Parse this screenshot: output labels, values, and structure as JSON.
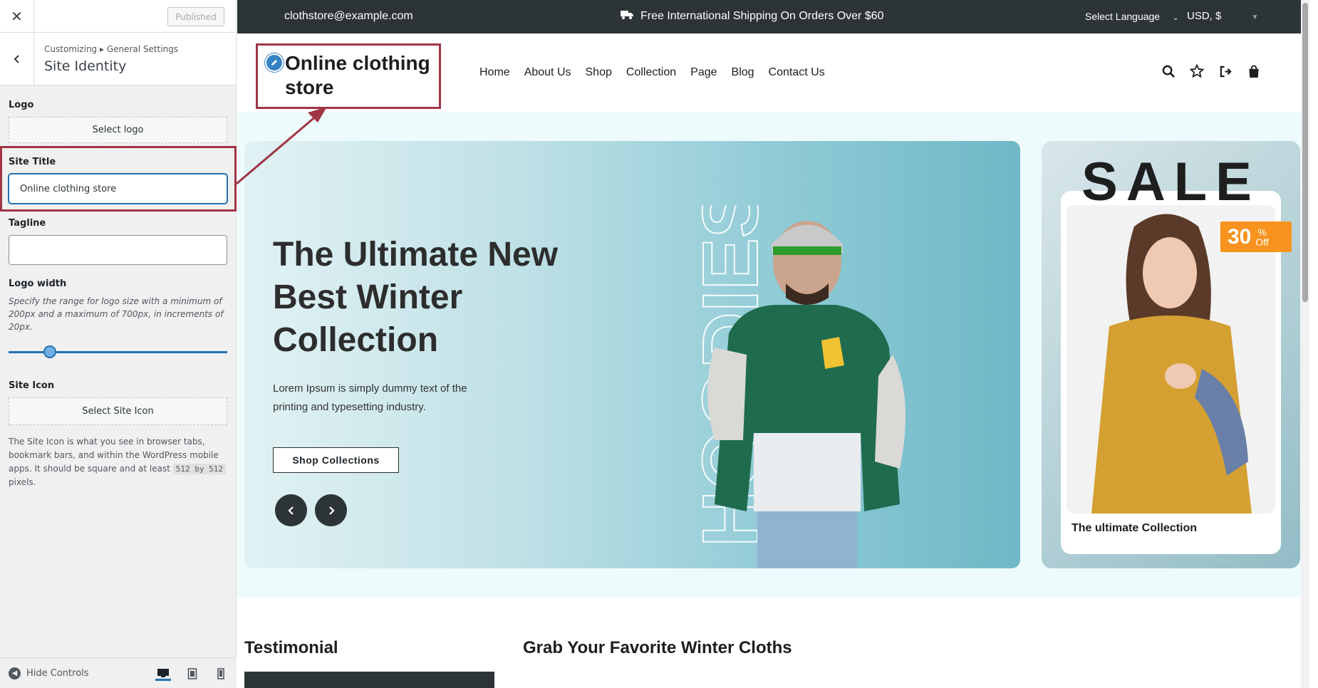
{
  "customizer": {
    "close_glyph": "✕",
    "published_label": "Published",
    "breadcrumb": "Customizing ▸ General Settings",
    "section_title": "Site Identity",
    "logo": {
      "label": "Logo",
      "button": "Select logo"
    },
    "site_title": {
      "label": "Site Title",
      "value": "Online clothing store"
    },
    "tagline": {
      "label": "Tagline",
      "value": ""
    },
    "logo_width": {
      "label": "Logo width",
      "hint": "Specify the range for logo size with a minimum of 200px and a maximum of 700px, in increments of 20px.",
      "value_fraction": 0.19
    },
    "site_icon": {
      "label": "Site Icon",
      "button": "Select Site Icon",
      "help_before": "The Site Icon is what you see in browser tabs, bookmark bars, and within the WordPress mobile apps. It should be square and at least",
      "help_code": "512 by 512",
      "help_after": "pixels."
    },
    "hide_controls": "Hide Controls",
    "devices": [
      "desktop-icon",
      "tablet-icon",
      "mobile-icon"
    ]
  },
  "topbar": {
    "email": "clothstore@example.com",
    "shipping": "Free International Shipping On Orders Over $60",
    "language": "Select Language",
    "currency": "USD, $"
  },
  "header": {
    "site_title": "Online clothing store",
    "nav": [
      "Home",
      "About Us",
      "Shop",
      "Collection",
      "Page",
      "Blog",
      "Contact Us"
    ]
  },
  "hero": {
    "heading": "The Ultimate New Best Winter Collection",
    "text": "Lorem Ipsum is simply dummy text of the printing and typesetting industry.",
    "button": "Shop Collections",
    "vertical_word": "HOODIES"
  },
  "sale": {
    "word": "SALE",
    "badge_number": "30",
    "badge_pct": "%",
    "badge_off": "Off",
    "caption": "The ultimate Collection"
  },
  "sections": {
    "testimonial": "Testimonial",
    "grab": "Grab Your Favorite Winter Cloths"
  },
  "colors": {
    "highlight": "#a03545",
    "accent": "#2271b1",
    "topbar": "#2d3436",
    "badge": "#f7931e"
  }
}
